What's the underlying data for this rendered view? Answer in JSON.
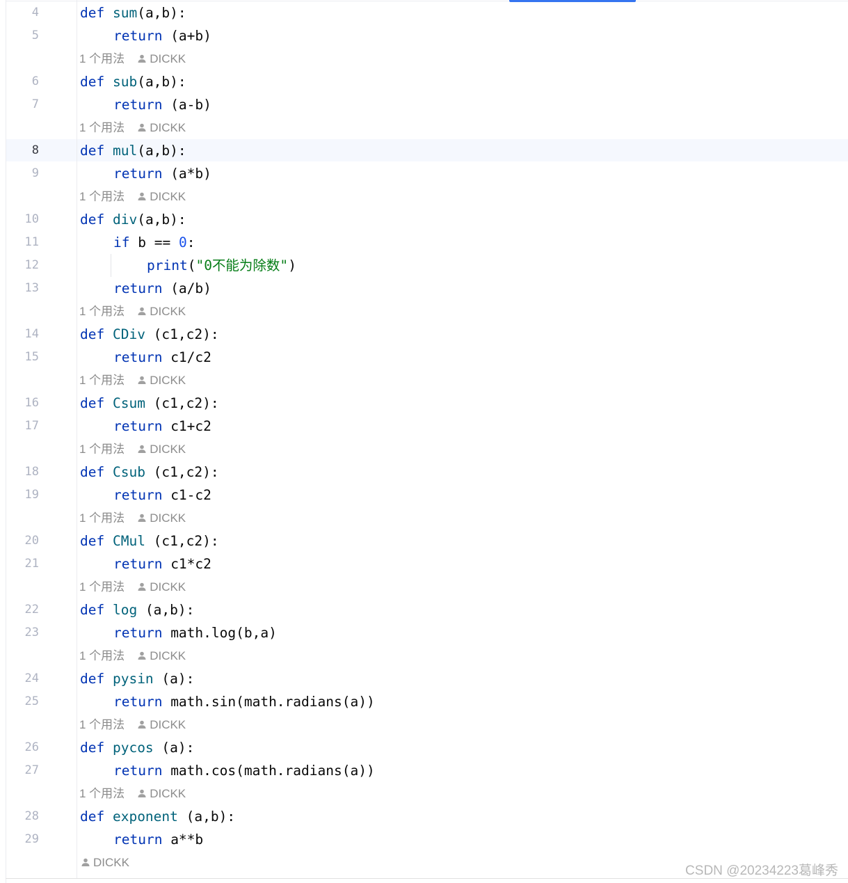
{
  "code_lines": [
    {
      "n": "4",
      "indent": 0,
      "tokens": [
        [
          "kw",
          "def "
        ],
        [
          "fn",
          "sum"
        ],
        [
          "p",
          "(a,b):"
        ]
      ]
    },
    {
      "n": "5",
      "indent": 1,
      "tokens": [
        [
          "kw",
          "return "
        ],
        [
          "p",
          "(a+b)"
        ]
      ]
    },
    {
      "hint": true,
      "usage": "1 个用法",
      "author": "DICKK"
    },
    {
      "n": "6",
      "indent": 0,
      "tokens": [
        [
          "kw",
          "def "
        ],
        [
          "fn",
          "sub"
        ],
        [
          "p",
          "(a,b):"
        ]
      ]
    },
    {
      "n": "7",
      "indent": 1,
      "tokens": [
        [
          "kw",
          "return "
        ],
        [
          "p",
          "(a-b)"
        ]
      ]
    },
    {
      "hint": true,
      "usage": "1 个用法",
      "author": "DICKK"
    },
    {
      "n": "8",
      "indent": 0,
      "active": true,
      "tokens": [
        [
          "kw",
          "def "
        ],
        [
          "fn",
          "mul"
        ],
        [
          "p",
          "(a,b):"
        ]
      ]
    },
    {
      "n": "9",
      "indent": 1,
      "tokens": [
        [
          "kw",
          "return "
        ],
        [
          "p",
          "(a*b)"
        ]
      ]
    },
    {
      "hint": true,
      "usage": "1 个用法",
      "author": "DICKK"
    },
    {
      "n": "10",
      "indent": 0,
      "tokens": [
        [
          "kw",
          "def "
        ],
        [
          "fn",
          "div"
        ],
        [
          "p",
          "(a,b):"
        ]
      ]
    },
    {
      "n": "11",
      "indent": 1,
      "tokens": [
        [
          "kw",
          "if "
        ],
        [
          "p",
          "b == "
        ],
        [
          "num",
          "0"
        ],
        [
          "p",
          ":"
        ]
      ]
    },
    {
      "n": "12",
      "indent": 2,
      "tokens": [
        [
          "kw",
          "print"
        ],
        [
          "p",
          "("
        ],
        [
          "str",
          "\"0不能为除数\""
        ],
        [
          "p",
          ")"
        ]
      ]
    },
    {
      "n": "13",
      "indent": 1,
      "tokens": [
        [
          "kw",
          "return "
        ],
        [
          "p",
          "(a/b)"
        ]
      ]
    },
    {
      "hint": true,
      "usage": "1 个用法",
      "author": "DICKK"
    },
    {
      "n": "14",
      "indent": 0,
      "tokens": [
        [
          "kw",
          "def "
        ],
        [
          "fn",
          "CDiv"
        ],
        [
          "p",
          " (c1,c2):"
        ]
      ]
    },
    {
      "n": "15",
      "indent": 1,
      "tokens": [
        [
          "kw",
          "return "
        ],
        [
          "p",
          "c1/c2"
        ]
      ]
    },
    {
      "hint": true,
      "usage": "1 个用法",
      "author": "DICKK"
    },
    {
      "n": "16",
      "indent": 0,
      "tokens": [
        [
          "kw",
          "def "
        ],
        [
          "fn",
          "Csum"
        ],
        [
          "p",
          " (c1,c2):"
        ]
      ]
    },
    {
      "n": "17",
      "indent": 1,
      "tokens": [
        [
          "kw",
          "return "
        ],
        [
          "p",
          "c1+c2"
        ]
      ]
    },
    {
      "hint": true,
      "usage": "1 个用法",
      "author": "DICKK"
    },
    {
      "n": "18",
      "indent": 0,
      "tokens": [
        [
          "kw",
          "def "
        ],
        [
          "fn",
          "Csub"
        ],
        [
          "p",
          " (c1,c2):"
        ]
      ]
    },
    {
      "n": "19",
      "indent": 1,
      "tokens": [
        [
          "kw",
          "return "
        ],
        [
          "p",
          "c1-c2"
        ]
      ]
    },
    {
      "hint": true,
      "usage": "1 个用法",
      "author": "DICKK"
    },
    {
      "n": "20",
      "indent": 0,
      "tokens": [
        [
          "kw",
          "def "
        ],
        [
          "fn",
          "CMul"
        ],
        [
          "p",
          " (c1,c2):"
        ]
      ]
    },
    {
      "n": "21",
      "indent": 1,
      "tokens": [
        [
          "kw",
          "return "
        ],
        [
          "p",
          "c1*c2"
        ]
      ]
    },
    {
      "hint": true,
      "usage": "1 个用法",
      "author": "DICKK"
    },
    {
      "n": "22",
      "indent": 0,
      "tokens": [
        [
          "kw",
          "def "
        ],
        [
          "fn",
          "log"
        ],
        [
          "p",
          " (a,b):"
        ]
      ]
    },
    {
      "n": "23",
      "indent": 1,
      "tokens": [
        [
          "kw",
          "return "
        ],
        [
          "p",
          "math.log(b,a)"
        ]
      ]
    },
    {
      "hint": true,
      "usage": "1 个用法",
      "author": "DICKK"
    },
    {
      "n": "24",
      "indent": 0,
      "tokens": [
        [
          "kw",
          "def "
        ],
        [
          "fn",
          "pysin"
        ],
        [
          "p",
          " (a):"
        ]
      ]
    },
    {
      "n": "25",
      "indent": 1,
      "tokens": [
        [
          "kw",
          "return "
        ],
        [
          "p",
          "math.sin(math.radians(a))"
        ]
      ]
    },
    {
      "hint": true,
      "usage": "1 个用法",
      "author": "DICKK"
    },
    {
      "n": "26",
      "indent": 0,
      "tokens": [
        [
          "kw",
          "def "
        ],
        [
          "fn",
          "pycos"
        ],
        [
          "p",
          " (a):"
        ]
      ]
    },
    {
      "n": "27",
      "indent": 1,
      "tokens": [
        [
          "kw",
          "return "
        ],
        [
          "p",
          "math.cos(math.radians(a))"
        ]
      ]
    },
    {
      "hint": true,
      "usage": "1 个用法",
      "author": "DICKK"
    },
    {
      "n": "28",
      "indent": 0,
      "tokens": [
        [
          "kw",
          "def "
        ],
        [
          "fn",
          "exponent"
        ],
        [
          "p",
          " (a,b):"
        ]
      ]
    },
    {
      "n": "29",
      "indent": 1,
      "tokens": [
        [
          "kw",
          "return "
        ],
        [
          "p",
          "a**b"
        ]
      ]
    },
    {
      "hint": true,
      "usage": "",
      "author": "DICKK"
    }
  ],
  "watermark": "CSDN @20234223葛峰秀",
  "colors": {
    "keyword": "#0033b3",
    "function_name": "#00627a",
    "number": "#1750eb",
    "string": "#067d17",
    "hint": "#8c8c8c",
    "line_number": "#aeb3c2",
    "current_line_bg": "#f5f8fe",
    "accent": "#3574f0"
  },
  "icons": {
    "author_icon": "person-icon"
  }
}
